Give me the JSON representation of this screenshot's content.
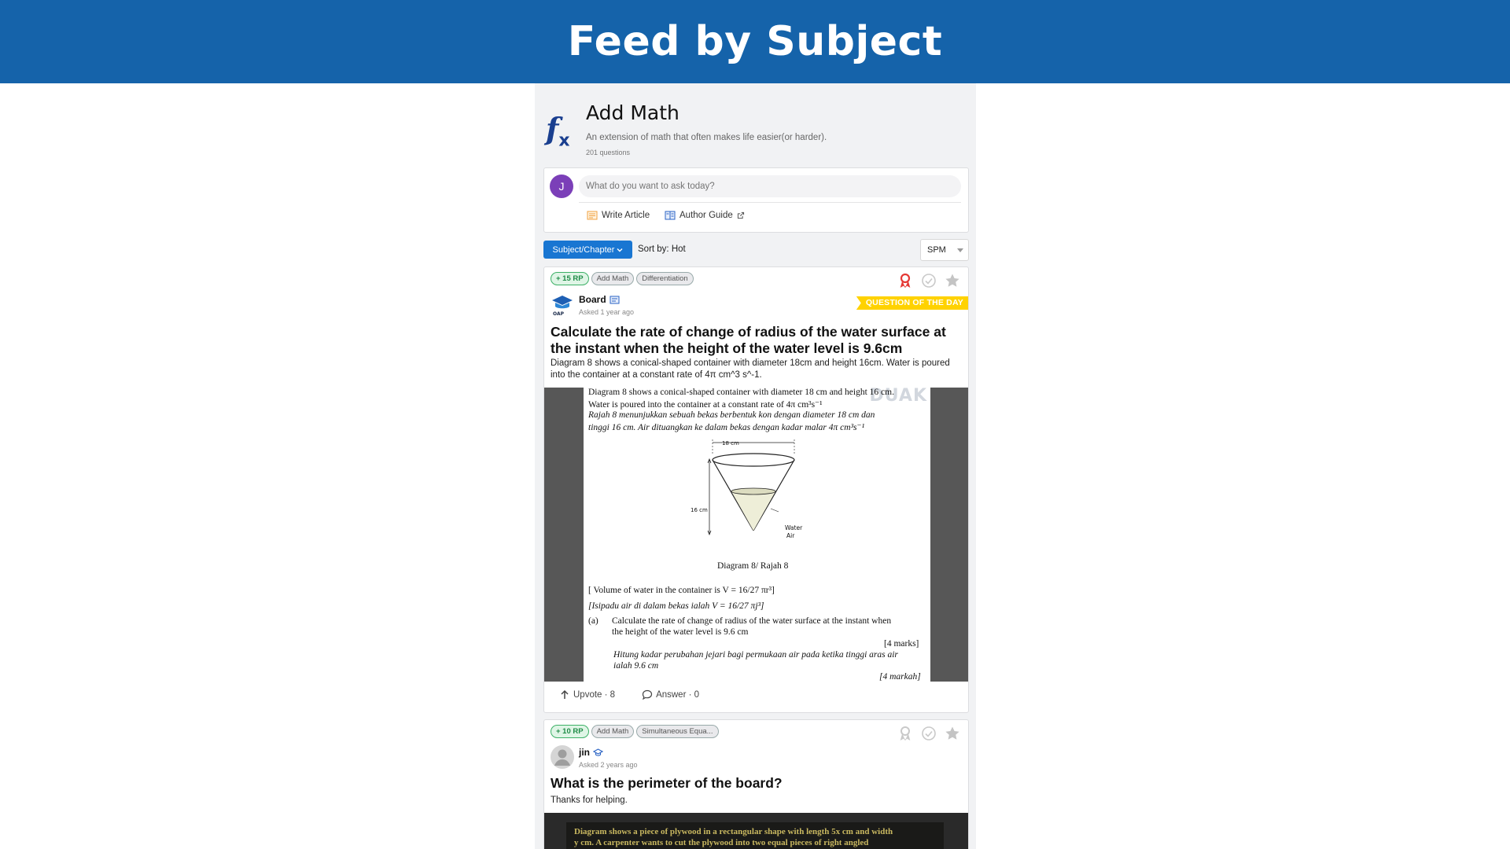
{
  "banner": {
    "title": "Feed by Subject"
  },
  "subject": {
    "icon": "fx-function-icon",
    "name": "Add Math",
    "description": "An extension of math that often makes life easier(or harder).",
    "count": "201 questions"
  },
  "ask": {
    "avatar_letter": "J",
    "placeholder": "What do you want to ask today?",
    "write_article": "Write Article",
    "author_guide": "Author Guide"
  },
  "filters": {
    "subject_chapter": "Subject/Chapter",
    "sort": "Sort by: Hot",
    "exam": "SPM"
  },
  "posts": [
    {
      "rp": "+ 15 RP",
      "tags": [
        "Add Math",
        "Differentiation"
      ],
      "badge": "QUESTION OF THE DAY",
      "author": "Board",
      "asked": "Asked 1 year ago",
      "title": "Calculate the rate of change of radius of the water surface at the instant when the height of the water level is 9.6cm",
      "body": "Diagram 8 shows a conical-shaped container with diameter 18cm and height 16cm. Water is poured into the container at a constant rate of 4π cm^3 s^-1.",
      "image_text": {
        "watermark": "DUAK",
        "l1": "Diagram 8 shows a conical-shaped container with diameter 18 cm and height 16 cm.",
        "l2": "Water is poured into the container at a constant rate of 4π cm³s⁻¹",
        "l3": "Rajah 8 menunjukkan sebuah bekas berbentuk kon dengan diameter 18 cm dan",
        "l4": "tinggi 16 cm. Air dituangkan ke dalam bekas dengan kadar malar 4π cm³s⁻¹",
        "dim_top": "18 cm",
        "dim_side": "16 cm",
        "water": "Water",
        "air": "Air",
        "caption": "Diagram 8/ Rajah 8",
        "l5": "[ Volume of water in the container is V = 16/27 πr³]",
        "l6": "[Isipadu air di dalam bekas ialah V = 16/27 πj³]",
        "l7a": "(a)",
        "l7": "Calculate the rate of change of radius of the water surface at the instant when",
        "l8": "the height of the water level is 9.6 cm",
        "l9": "[4 marks]",
        "l10": "Hitung kadar perubahan jejari bagi permukaan air pada ketika tinggi aras air",
        "l11": "ialah 9.6 cm",
        "l12": "[4 markah]"
      },
      "upvote": "Upvote · 8",
      "answer": "Answer · 0"
    },
    {
      "rp": "+ 10 RP",
      "tags": [
        "Add Math",
        "Simultaneous Equa..."
      ],
      "author": "jin",
      "asked": "Asked 2 years ago",
      "title": "What is the perimeter of the board?",
      "body": "Thanks for helping.",
      "image_text": {
        "l1": "Diagram shows a piece of plywood in a rectangular shape with length 5x cm and width",
        "l2": "y cm. A carpenter wants to cut the plywood into two equal pieces of right angled"
      }
    }
  ],
  "colors": {
    "banner": "#1563aa",
    "accent": "#1976d2",
    "badge": "#ffd200",
    "rp_green": "#1f8c47"
  }
}
